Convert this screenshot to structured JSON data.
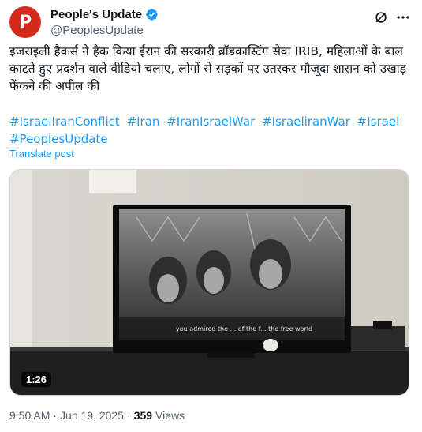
{
  "author": {
    "display_name": "People's Update",
    "handle": "@PeoplesUpdate",
    "avatar_letter": "P"
  },
  "post": {
    "text": "इजराइली हैकर्स ने हैक किया ईरान की सरकारी ब्रॉडकास्टिंग सेवा IRIB, महिलाओं के बाल काटते हुए प्रदर्शन वाले वीडियो चलाए, लोगों से सड़कों पर उतरकर मौजूदा शासन को उखाड़ फेंकने की अपील की",
    "hashtags": [
      "#IsraelIranConflict",
      "#Iran",
      "#IranIsraelWar",
      "#IsraeliranWar",
      "#Israel",
      "#PeoplesUpdate"
    ],
    "translate_label": "Translate post"
  },
  "media": {
    "duration": "1:26",
    "subtitle_text": "you admired the ... of the f... the free world"
  },
  "meta": {
    "time": "9:50 AM",
    "separator": "·",
    "date": "Jun 19, 2025",
    "views_count": "359",
    "views_label": "Views"
  },
  "colors": {
    "link": "#1d9bf0",
    "avatar": "#d42a1c",
    "secondary_text": "#536471"
  }
}
